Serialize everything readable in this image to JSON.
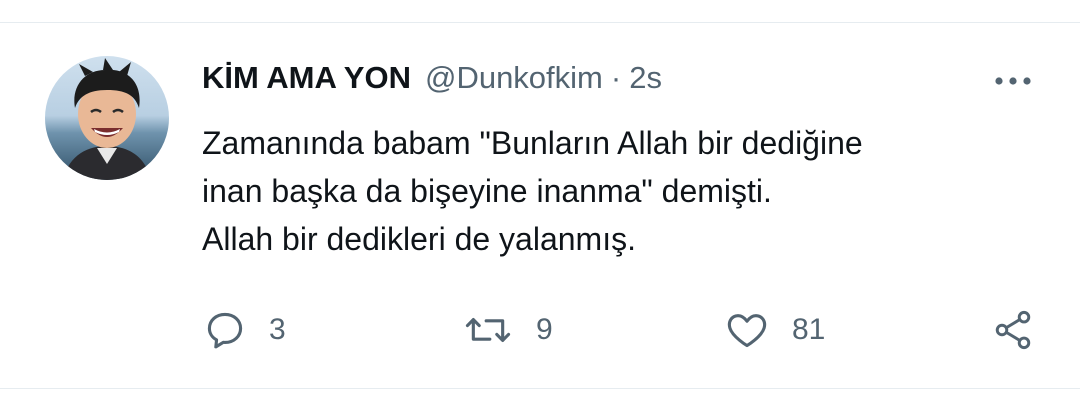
{
  "tweet": {
    "display_name": "KİM AMA YON",
    "handle": "@Dunkofkim",
    "separator": "·",
    "time": "2s",
    "text_lines": [
      "Zamanında babam \"Bunların Allah bir dediğine",
      "inan başka da bişeyine inanma\" demişti.",
      "Allah bir dedikleri de yalanmış."
    ]
  },
  "actions": {
    "reply_count": "3",
    "retweet_count": "9",
    "like_count": "81"
  },
  "icons": {
    "avatar": "user-avatar",
    "more": "more-options-icon",
    "reply": "reply-icon",
    "retweet": "retweet-icon",
    "like": "heart-icon",
    "share": "share-icon"
  },
  "colors": {
    "text": "#0f1419",
    "secondary": "#536471",
    "divider": "#e6ecf0"
  }
}
